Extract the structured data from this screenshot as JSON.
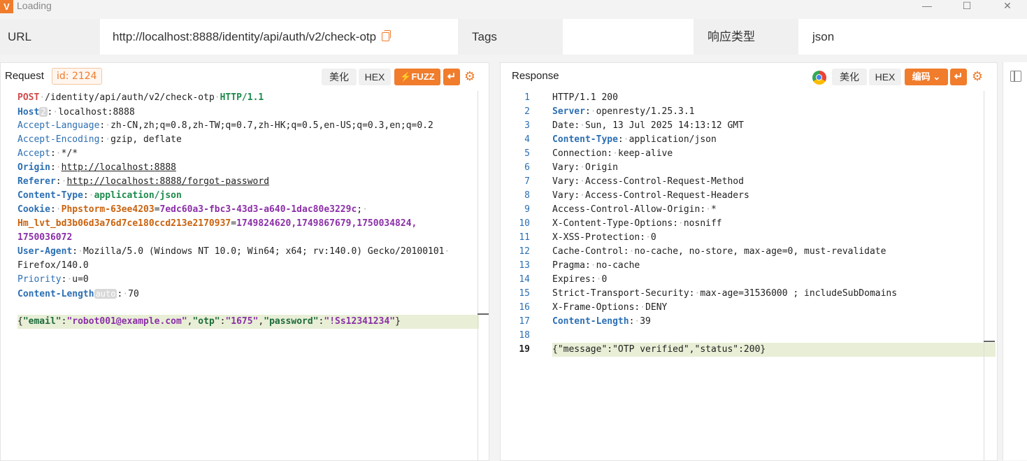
{
  "window": {
    "title": "Loading",
    "logo": "V",
    "minimize_icon": "minimize-icon",
    "maximize_icon": "maximize-icon",
    "close_icon": "close-icon"
  },
  "infobar": {
    "url_label": "URL",
    "url_value": "http://localhost:8888/identity/api/auth/v2/check-otp",
    "tags_label": "Tags",
    "tags_value": "",
    "response_type_label": "响应类型",
    "response_type_value": "json"
  },
  "request": {
    "title": "Request",
    "id_badge": "id: 2124",
    "beautify": "美化",
    "hex": "HEX",
    "fuzz": "⚡FUZZ",
    "method": "POST",
    "path": "/identity/api/auth/v2/check-otp",
    "version": "HTTP/1.1",
    "host_badge": "2",
    "content_length_badge": "auto",
    "headers": [
      {
        "k": "Host",
        "v": "localhost:8888"
      },
      {
        "k": "Accept-Language",
        "v": "zh-CN,zh;q=0.8,zh-TW;q=0.7,zh-HK;q=0.5,en-US;q=0.3,en;q=0.2"
      },
      {
        "k": "Accept-Encoding",
        "v": "gzip, deflate"
      },
      {
        "k": "Accept",
        "v": "*/*"
      },
      {
        "k": "Origin",
        "v": "http://localhost:8888"
      },
      {
        "k": "Referer",
        "v": "http://localhost:8888/forgot-password"
      },
      {
        "k": "Content-Type",
        "v": "application/json"
      },
      {
        "k": "Cookie",
        "v": ""
      },
      {
        "k": "User-Agent",
        "v": "Mozilla/5.0 (Windows NT 10.0; Win64; x64; rv:140.0) Gecko/20100101"
      },
      {
        "k": "Priority",
        "v": "u=0"
      },
      {
        "k": "Content-Length",
        "v": "70"
      }
    ],
    "cookie1_name": "Phpstorm-63ee4203",
    "cookie1_value": "7edc60a3-fbc3-43d3-a640-1dac80e3229c",
    "cookie2_name": "Hm_lvt_bd3b06d3a76d7ce180ccd213e2170937",
    "cookie2_value": "1749824620,1749867679,1750034824,",
    "cookie2_cont": "1750036072",
    "ua_cont": "Firefox/140.0",
    "body": {
      "email": "robot001@example.com",
      "otp": "1675",
      "password": "!Ss12341234"
    }
  },
  "response": {
    "title": "Response",
    "beautify": "美化",
    "hex": "HEX",
    "encoding": "编码",
    "lines": [
      {
        "n": "1",
        "text": "HTTP/1.1 200",
        "style": "plain"
      },
      {
        "n": "2",
        "k": "Server",
        "v": "openresty/1.25.3.1",
        "style": "bold"
      },
      {
        "n": "3",
        "k": "Date",
        "v": "Sun, 13 Jul 2025 14:13:12 GMT",
        "style": "plain"
      },
      {
        "n": "4",
        "k": "Content-Type",
        "v": "application/json",
        "style": "bold"
      },
      {
        "n": "5",
        "k": "Connection",
        "v": "keep-alive",
        "style": "plain"
      },
      {
        "n": "6",
        "k": "Vary",
        "v": "Origin",
        "style": "plain"
      },
      {
        "n": "7",
        "k": "Vary",
        "v": "Access-Control-Request-Method",
        "style": "plain"
      },
      {
        "n": "8",
        "k": "Vary",
        "v": "Access-Control-Request-Headers",
        "style": "plain"
      },
      {
        "n": "9",
        "k": "Access-Control-Allow-Origin",
        "v": "*",
        "style": "plain"
      },
      {
        "n": "10",
        "k": "X-Content-Type-Options",
        "v": "nosniff",
        "style": "plain"
      },
      {
        "n": "11",
        "k": "X-XSS-Protection",
        "v": "0",
        "style": "plain"
      },
      {
        "n": "12",
        "k": "Cache-Control",
        "v": "no-cache, no-store, max-age=0, must-revalidate",
        "style": "plain"
      },
      {
        "n": "13",
        "k": "Pragma",
        "v": "no-cache",
        "style": "plain"
      },
      {
        "n": "14",
        "k": "Expires",
        "v": "0",
        "style": "plain"
      },
      {
        "n": "15",
        "k": "Strict-Transport-Security",
        "v": "max-age=31536000 ; includeSubDomains",
        "style": "plain"
      },
      {
        "n": "16",
        "k": "X-Frame-Options",
        "v": "DENY",
        "style": "plain"
      },
      {
        "n": "17",
        "k": "Content-Length",
        "v": "39",
        "style": "bold"
      },
      {
        "n": "18",
        "text": "",
        "style": "plain"
      },
      {
        "n": "19",
        "text": "{\"message\":\"OTP verified\",\"status\":200}",
        "style": "body"
      }
    ]
  }
}
